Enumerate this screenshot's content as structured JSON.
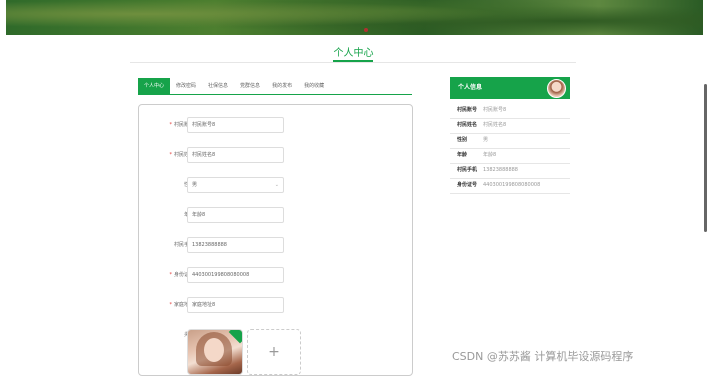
{
  "page_title": "个人中心",
  "tabs": [
    {
      "label": "个人中心",
      "active": true
    },
    {
      "label": "修改密码"
    },
    {
      "label": "社保信息"
    },
    {
      "label": "党群信息"
    },
    {
      "label": "我的发布"
    },
    {
      "label": "我的收藏"
    }
  ],
  "form": {
    "fields": [
      {
        "label": "村民账号",
        "required": true,
        "value": "村民账号8"
      },
      {
        "label": "村民姓名",
        "required": true,
        "value": "村民姓名8"
      },
      {
        "label": "性别",
        "required": false,
        "value": "男",
        "type": "select"
      },
      {
        "label": "年龄",
        "required": false,
        "value": "年龄8"
      },
      {
        "label": "村民手机",
        "required": false,
        "value": "13823888888"
      },
      {
        "label": "身份证号",
        "required": true,
        "value": "440300199808080008"
      },
      {
        "label": "家庭地址",
        "required": true,
        "value": "家庭地址8"
      }
    ],
    "avatar_label": "头像",
    "upload_plus": "+"
  },
  "info": {
    "title": "个人信息",
    "rows": [
      {
        "key": "村民账号",
        "value": "村民账号8"
      },
      {
        "key": "村民姓名",
        "value": "村民姓名8"
      },
      {
        "key": "性别",
        "value": "男"
      },
      {
        "key": "年龄",
        "value": "年龄8"
      },
      {
        "key": "村民手机",
        "value": "13823888888"
      },
      {
        "key": "身份证号",
        "value": "440300199808080008"
      }
    ]
  },
  "watermark": "CSDN @苏苏酱    计算机毕设源码程序",
  "colors": {
    "accent": "#16a34a",
    "required": "#e53935"
  }
}
